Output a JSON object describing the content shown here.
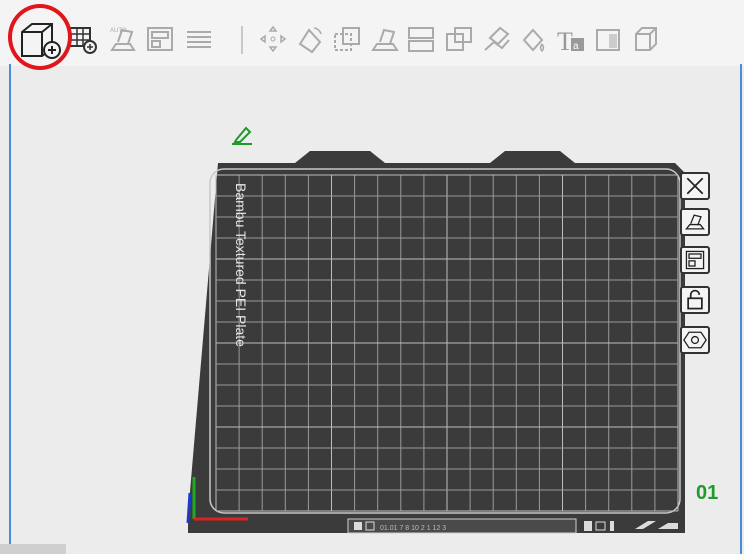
{
  "toolbar": {
    "items": [
      {
        "name": "add-object-button",
        "icon": "cube-plus-icon"
      },
      {
        "name": "add-plate-button",
        "icon": "grid-plus-icon"
      },
      {
        "name": "auto-orient-button",
        "icon": "auto-orient-icon"
      },
      {
        "name": "arrange-button",
        "icon": "arrange-icon"
      },
      {
        "name": "layers-button",
        "icon": "layers-icon"
      },
      {
        "name": "move-button",
        "icon": "move-icon"
      },
      {
        "name": "rotate-button",
        "icon": "rotate-icon"
      },
      {
        "name": "scale-button",
        "icon": "scale-icon"
      },
      {
        "name": "lay-on-face-button",
        "icon": "lay-on-face-icon"
      },
      {
        "name": "split-button",
        "icon": "split-icon"
      },
      {
        "name": "cut-button",
        "icon": "cut-icon"
      },
      {
        "name": "support-paint-button",
        "icon": "support-paint-icon"
      },
      {
        "name": "color-paint-button",
        "icon": "color-paint-icon"
      },
      {
        "name": "text-button",
        "icon": "text-icon",
        "label": "Ta"
      },
      {
        "name": "seam-button",
        "icon": "seam-icon"
      },
      {
        "name": "measure-button",
        "icon": "measure-icon"
      }
    ]
  },
  "plate": {
    "label": "Bambu Textured PEI Plate",
    "number": "01",
    "footer_text": "01.01 7 8 10 2 1 12 3"
  },
  "right_tools": [
    {
      "name": "delete-plate-button",
      "icon": "close-icon"
    },
    {
      "name": "auto-orient-plate-button",
      "icon": "auto-orient-icon"
    },
    {
      "name": "arrange-plate-button",
      "icon": "arrange-icon"
    },
    {
      "name": "lock-plate-button",
      "icon": "lock-icon"
    },
    {
      "name": "plate-settings-button",
      "icon": "hexagon-icon"
    }
  ],
  "colors": {
    "accent_red": "#e0161b",
    "plate_number_green": "#1f9a2b",
    "plate_body": "#3b3b3b",
    "grid_line": "#9a9a9a"
  }
}
